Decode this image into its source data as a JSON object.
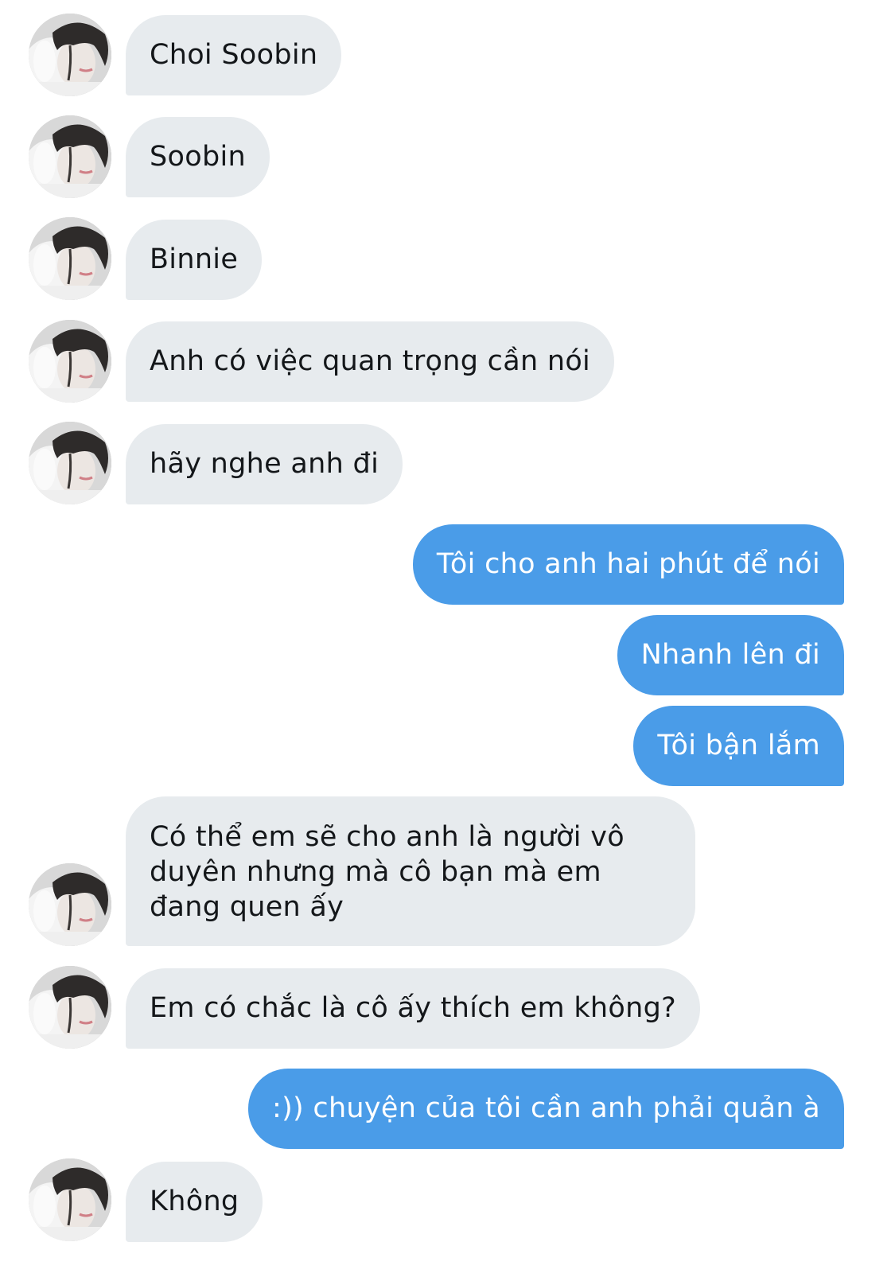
{
  "conversation": {
    "messages": [
      {
        "side": "in",
        "text": "Choi Soobin"
      },
      {
        "side": "in",
        "text": "Soobin"
      },
      {
        "side": "in",
        "text": "Binnie"
      },
      {
        "side": "in",
        "text": "Anh có việc quan trọng cần nói"
      },
      {
        "side": "in",
        "text": "hãy nghe anh đi"
      },
      {
        "side": "out",
        "text": "Tôi cho anh hai phút để nói"
      },
      {
        "side": "out",
        "text": "Nhanh lên đi"
      },
      {
        "side": "out",
        "text": "Tôi bận lắm"
      },
      {
        "side": "in",
        "text": "Có thể em sẽ cho anh là người vô duyên nhưng mà cô bạn mà em đang quen ấy"
      },
      {
        "side": "in",
        "text": "Em có chắc là cô ấy thích em không?"
      },
      {
        "side": "out",
        "text": ":)) chuyện của tôi cần anh phải quản à"
      },
      {
        "side": "in",
        "text": "Không"
      }
    ]
  },
  "colors": {
    "incoming_bubble": "#e7ebee",
    "outgoing_bubble": "#4a9ce8",
    "incoming_text": "#14171a",
    "outgoing_text": "#ffffff"
  },
  "icons": {
    "avatar": "contact-avatar-photo"
  }
}
